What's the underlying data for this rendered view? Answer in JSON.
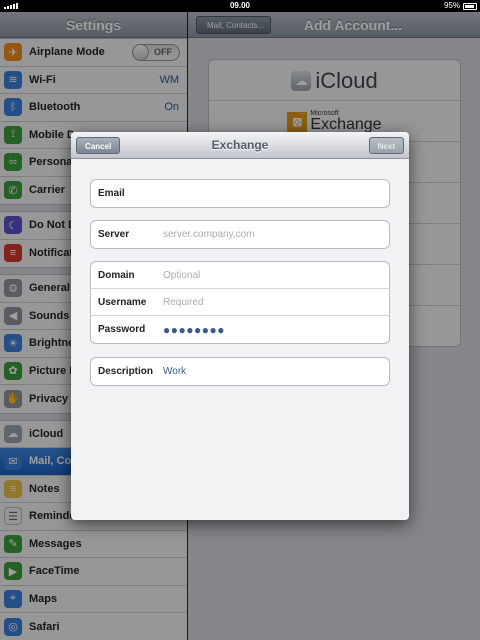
{
  "status_bar": {
    "time": "09.00",
    "battery": "95%"
  },
  "settings": {
    "title": "Settings",
    "groups": [
      [
        {
          "label": "Airplane Mode",
          "icon": "airplane-icon",
          "color": "#f08c1c",
          "glyph": "✈",
          "toggle": "OFF"
        },
        {
          "label": "Wi-Fi",
          "icon": "wifi-icon",
          "color": "#3a7fd9",
          "glyph": "≋",
          "value": "WM"
        },
        {
          "label": "Bluetooth",
          "icon": "bluetooth-icon",
          "color": "#3a7fd9",
          "glyph": "ᛒ",
          "value": "On"
        },
        {
          "label": "Mobile D",
          "icon": "mobile-data-icon",
          "color": "#3c9b3c",
          "glyph": "⟟"
        },
        {
          "label": "Persona",
          "icon": "personal-hotspot-icon",
          "color": "#3c9b3c",
          "glyph": "∞"
        },
        {
          "label": "Carrier",
          "icon": "carrier-icon",
          "color": "#3c9b3c",
          "glyph": "✆"
        }
      ],
      [
        {
          "label": "Do Not D",
          "icon": "moon-icon",
          "color": "#5b4fc9",
          "glyph": "☾"
        },
        {
          "label": "Notificat",
          "icon": "notifications-icon",
          "color": "#d23a2e",
          "glyph": "≡"
        }
      ],
      [
        {
          "label": "General",
          "icon": "gear-icon",
          "color": "#8e949c",
          "glyph": "⚙"
        },
        {
          "label": "Sounds",
          "icon": "speaker-icon",
          "color": "#8e949c",
          "glyph": "◀"
        },
        {
          "label": "Brightne",
          "icon": "brightness-icon",
          "color": "#3a7fd9",
          "glyph": "☀"
        },
        {
          "label": "Picture F",
          "icon": "picture-frame-icon",
          "color": "#3c9b3c",
          "glyph": "✿"
        },
        {
          "label": "Privacy",
          "icon": "hand-icon",
          "color": "#8e949c",
          "glyph": "✋"
        }
      ],
      [
        {
          "label": "iCloud",
          "icon": "icloud-icon",
          "color": "#9aa3ae",
          "glyph": "☁"
        },
        {
          "label": "Mail, Co",
          "icon": "mail-icon",
          "color": "#3a7fd9",
          "glyph": "✉",
          "selected": true
        },
        {
          "label": "Notes",
          "icon": "notes-icon",
          "color": "#e8c14a",
          "glyph": "≡"
        },
        {
          "label": "Reminde",
          "icon": "reminders-icon",
          "color": "#f2f2f2",
          "glyph": "☰"
        },
        {
          "label": "Messages",
          "icon": "messages-icon",
          "color": "#3c9b3c",
          "glyph": "✎"
        },
        {
          "label": "FaceTime",
          "icon": "facetime-icon",
          "color": "#3c9b3c",
          "glyph": "▶"
        },
        {
          "label": "Maps",
          "icon": "maps-icon",
          "color": "#3a7fd9",
          "glyph": "⌖"
        },
        {
          "label": "Safari",
          "icon": "safari-icon",
          "color": "#3a7fd9",
          "glyph": "◎"
        }
      ]
    ]
  },
  "detail": {
    "back_label": "Mail, Contacts...",
    "title": "Add Account...",
    "accounts": {
      "icloud": "iCloud",
      "exchange_prefix": "Microsoft",
      "exchange": "Exchange"
    }
  },
  "modal": {
    "title": "Exchange",
    "cancel": "Cancel",
    "next": "Next",
    "fields": {
      "email": {
        "label": "Email",
        "value": ""
      },
      "server": {
        "label": "Server",
        "placeholder": "server.company.com"
      },
      "domain": {
        "label": "Domain",
        "placeholder": "Optional"
      },
      "username": {
        "label": "Username",
        "placeholder": "Required"
      },
      "password": {
        "label": "Password",
        "value": "●●●●●●●●"
      },
      "description": {
        "label": "Description",
        "value": "Work"
      }
    }
  }
}
